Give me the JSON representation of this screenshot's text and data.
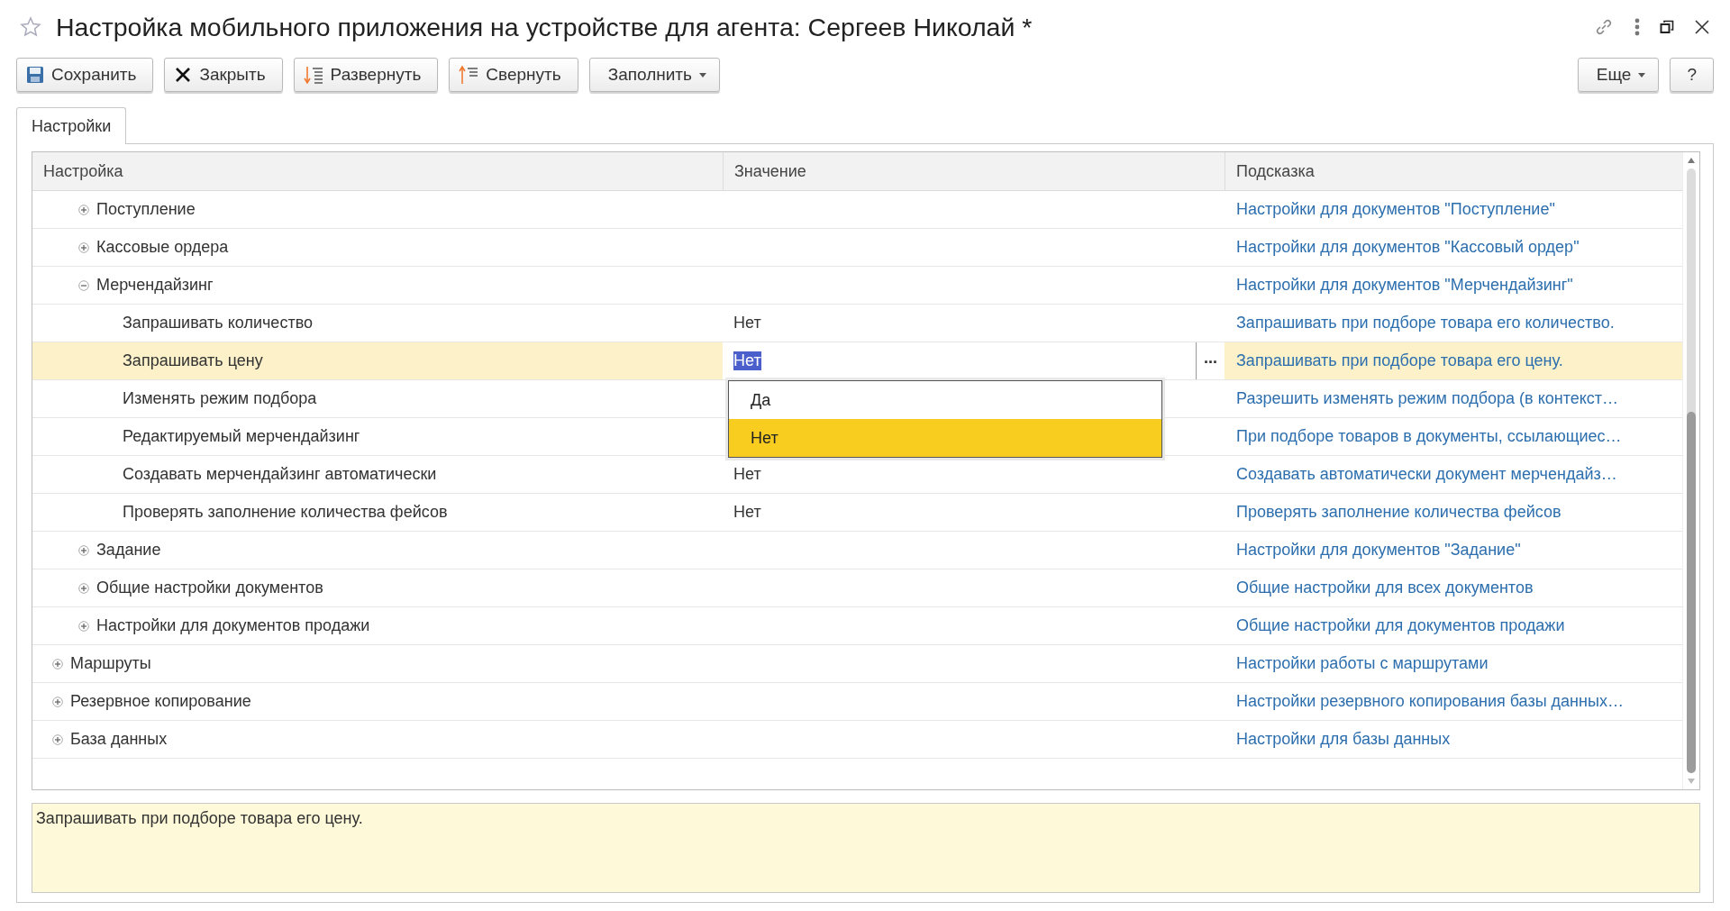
{
  "window": {
    "title": "Настройка мобильного приложения на устройстве для агента: Сергеев Николай *"
  },
  "toolbar": {
    "left": [
      {
        "label": "Сохранить",
        "kind": "save"
      },
      {
        "label": "Закрыть",
        "kind": "close"
      },
      {
        "label": "Развернуть",
        "kind": "expand"
      },
      {
        "label": "Свернуть",
        "kind": "collapse"
      },
      {
        "label": "Заполнить",
        "kind": "menu"
      }
    ],
    "right": [
      {
        "label": "Еще",
        "kind": "menu"
      },
      {
        "label": "?",
        "kind": "plain"
      }
    ]
  },
  "tabs": [
    {
      "label": "Настройки",
      "selected": true
    }
  ],
  "table": {
    "columns": [
      "Настройка",
      "Значение",
      "Подсказка"
    ],
    "rows": [
      {
        "children": [
          {
            "label": "Поступление",
            "expanded": false,
            "hint": "Настройки для документов \"Поступление\"",
            "selected": false
          },
          {
            "label": "Кассовые ордера",
            "expanded": false,
            "hint": "Настройки для документов \"Кассовый ордер\"",
            "selected": false
          },
          {
            "label": "Мерчендайзинг",
            "expanded": true,
            "hint": "Настройки для документов \"Мерчендайзинг\"",
            "selected": false,
            "children": [
              {
                "label": "Запрашивать количество",
                "value": "Нет",
                "hint": "Запрашивать при подборе товара его количество.",
                "selected": false,
                "editing": false
              },
              {
                "label": "Запрашивать цену",
                "value": "Нет",
                "hint": "Запрашивать при подборе товара его цену.",
                "selected": true,
                "editing": true,
                "choice_button": "...",
                "dropdown": {
                  "options": [
                    {
                      "label": "Да",
                      "selected": false
                    },
                    {
                      "label": "Нет",
                      "selected": true
                    }
                  ]
                }
              },
              {
                "label": "Изменять режим подбора",
                "hint": "Разрешить изменять режим подбора (в контекст…",
                "selected": false
              },
              {
                "label": "Редактируемый мерчендайзинг",
                "hint": "При подборе товаров в документы, ссылающиес…",
                "selected": false
              },
              {
                "label": "Создавать мерчендайзинг автоматически",
                "value": "Нет",
                "hint": "Создавать автоматически документ мерчендайз…",
                "selected": false,
                "editing": false
              },
              {
                "label": "Проверять заполнение количества фейсов",
                "value": "Нет",
                "hint": "Проверять заполнение количества фейсов",
                "selected": false,
                "editing": false
              }
            ]
          },
          {
            "label": "Задание",
            "expanded": false,
            "hint": "Настройки для документов \"Задание\"",
            "selected": false
          },
          {
            "label": "Общие настройки документов",
            "expanded": false,
            "hint": "Общие настройки для всех документов",
            "selected": false
          },
          {
            "label": "Настройки для документов продажи",
            "expanded": false,
            "hint": "Общие настройки для документов продажи",
            "selected": false
          }
        ]
      },
      {
        "label": "Маршруты",
        "expanded": false,
        "hint": "Настройки работы с маршрутами",
        "selected": false
      },
      {
        "label": "Резервное копирование",
        "expanded": false,
        "hint": "Настройки резервного копирования базы данных…",
        "selected": false
      },
      {
        "label": "База данных",
        "expanded": false,
        "hint": "Настройки для базы данных",
        "selected": false
      }
    ]
  },
  "hint_panel": {
    "text": "Запрашивать при подборе товара его цену."
  }
}
